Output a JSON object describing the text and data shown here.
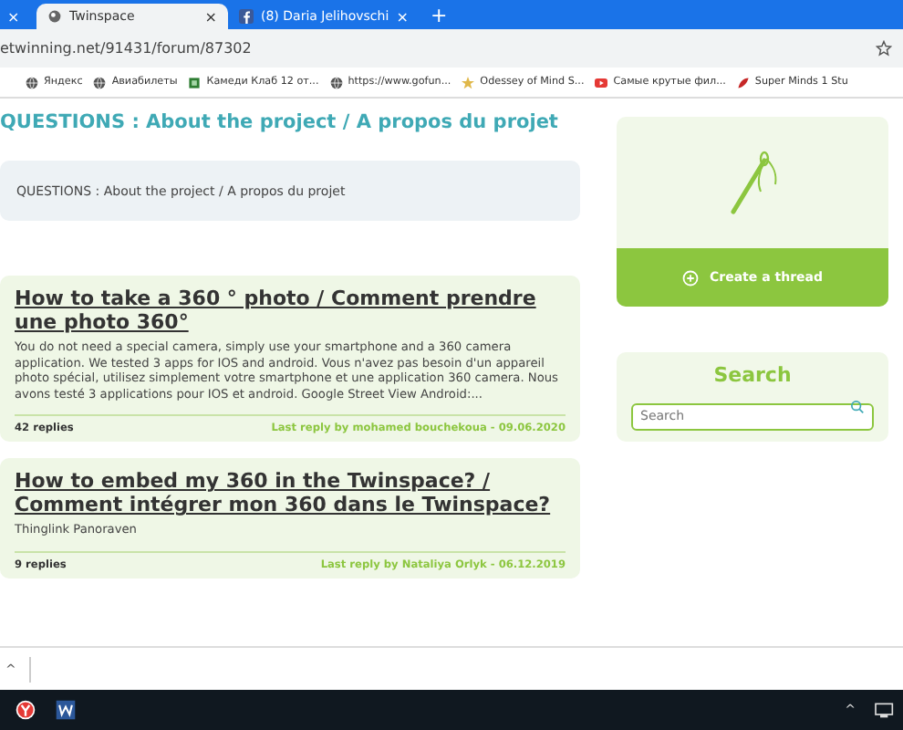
{
  "browser": {
    "tabs": [
      {
        "selected": false,
        "kind": "cut"
      },
      {
        "title": "Twinspace",
        "selected": true,
        "kind": "site"
      },
      {
        "title": "(8) Daria Jelihovschi",
        "selected": false,
        "kind": "facebook"
      }
    ],
    "new_tab": "+",
    "close": "×",
    "address": "etwinning.net/91431/forum/87302",
    "bookmarks": [
      {
        "label": "Яндекс",
        "kind": "globe"
      },
      {
        "label": "Авиабилеты",
        "kind": "globe"
      },
      {
        "label": "Камеди Клаб 12 от...",
        "kind": "square"
      },
      {
        "label": "https://www.gofun...",
        "kind": "globe"
      },
      {
        "label": "Odessey of Mind S...",
        "kind": "star"
      },
      {
        "label": "Самые крутые фил...",
        "kind": "video"
      },
      {
        "label": "Super Minds 1 Stu",
        "kind": "leaf"
      }
    ]
  },
  "page": {
    "title": "QUESTIONS : About the project / A propos du projet",
    "breadcrumb": "QUESTIONS : About the project / A propos du projet",
    "threads": [
      {
        "title": "How to take a 360 ° photo / Comment prendre une photo 360°",
        "excerpt": "You do not need a special camera, simply use your smartphone and a 360 camera application. We tested 3 apps for IOS and android. Vous n'avez pas besoin d'un appareil photo spécial, utilisez simplement votre smartphone et une application 360 camera. Nous avons testé 3 applications pour IOS et android.  Google Street View Android:...",
        "replies": "42 replies",
        "last_reply": "Last reply by mohamed bouchekoua - 09.06.2020"
      },
      {
        "title": "How to embed my 360 in the Twinspace? / Comment intégrer mon 360 dans le Twinspace?",
        "excerpt": "Thinglink Panoraven",
        "replies": "9 replies",
        "last_reply": "Last reply by Nataliya Orlyk - 06.12.2019"
      }
    ],
    "create_button": "Create a thread",
    "search": {
      "heading": "Search",
      "placeholder": "Search"
    }
  },
  "download_bar": {
    "caret": "^"
  },
  "taskbar": {
    "tray_caret": "^"
  }
}
